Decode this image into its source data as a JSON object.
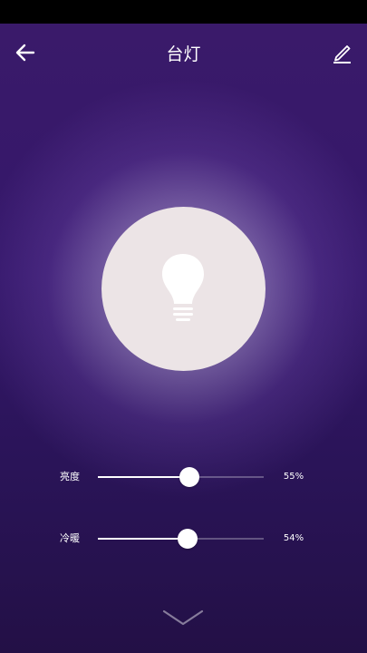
{
  "header": {
    "title": "台灯",
    "back_icon": "arrow-left-icon",
    "edit_icon": "pencil-icon"
  },
  "lamp": {
    "icon": "lightbulb-icon",
    "circle_color": "#ece4e6"
  },
  "sliders": [
    {
      "label": "亮度",
      "value_text": "55%",
      "value": 0.55
    },
    {
      "label": "冷暖",
      "value_text": "54%",
      "value": 0.54
    }
  ],
  "footer": {
    "expand_icon": "chevron-down-icon"
  },
  "colors": {
    "background": "#35176b",
    "accent": "#ffffff"
  }
}
